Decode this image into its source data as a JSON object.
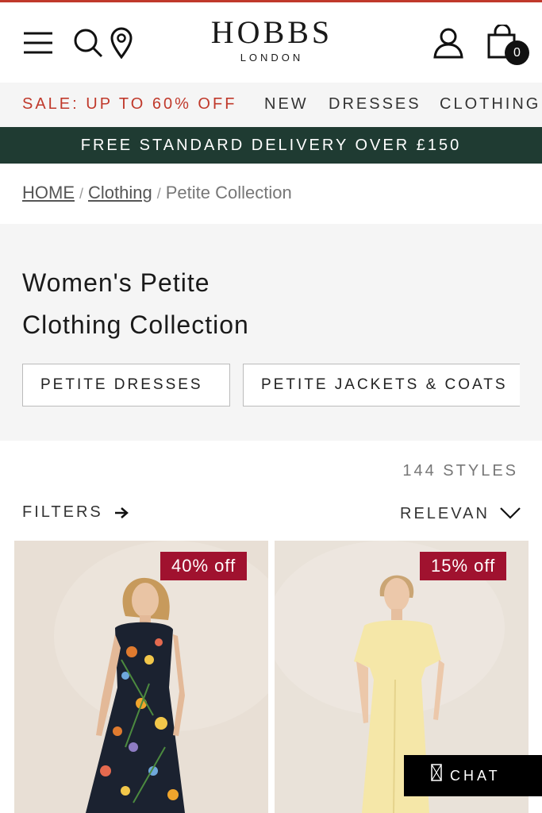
{
  "header": {
    "brand": "HOBBS",
    "brand_sub": "LONDON",
    "bag_count": "0",
    "icons": [
      "menu-icon",
      "search-icon",
      "location-pin-icon",
      "account-icon",
      "shopping-bag-icon"
    ]
  },
  "nav": {
    "items": [
      "SALE: UP TO 60% OFF",
      "NEW",
      "DRESSES",
      "CLOTHING"
    ]
  },
  "banner": {
    "text": "FREE STANDARD DELIVERY OVER £150"
  },
  "breadcrumb": {
    "home": "HOME",
    "clothing": "Clothing",
    "current": "Petite Collection",
    "sep": "/"
  },
  "hero": {
    "title_line1": "Women's Petite",
    "title_line2": "Clothing Collection",
    "chips": [
      "PETITE DRESSES",
      "PETITE JACKETS & COATS"
    ]
  },
  "listing": {
    "count": "144 STYLES",
    "filters_label": "FILTERS",
    "sort_label": "RELEVANCE"
  },
  "products": [
    {
      "badge": "40% off"
    },
    {
      "badge": "15% off"
    }
  ],
  "chat": {
    "label": "CHAT"
  },
  "colors": {
    "sale_red": "#c0392b",
    "banner_green": "#1f3b32",
    "badge_red": "#a0122f"
  }
}
